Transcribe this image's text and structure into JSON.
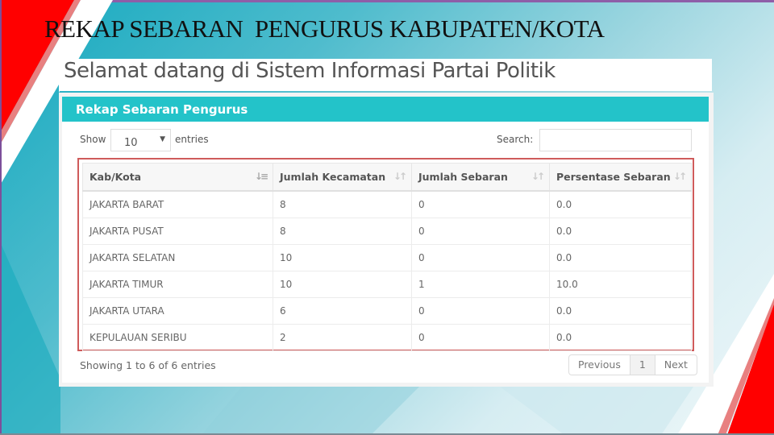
{
  "slide": {
    "title": "REKAP SEBARAN  PENGURUS KABUPATEN/KOTA"
  },
  "app": {
    "welcome": "Selamat datang di Sistem Informasi Partai Politik"
  },
  "panel": {
    "title": "Rekap Sebaran Pengurus",
    "show_label": "Show",
    "entries_value": "10",
    "entries_label": "entries",
    "search_label": "Search:",
    "search_value": "",
    "columns": [
      {
        "label": "Kab/Kota",
        "sort": "sorted-ascending"
      },
      {
        "label": "Jumlah Kecamatan",
        "sort": "sortable"
      },
      {
        "label": "Jumlah Sebaran",
        "sort": "sortable"
      },
      {
        "label": "Persentase Sebaran",
        "sort": "sortable"
      }
    ],
    "rows": [
      [
        "JAKARTA BARAT",
        "8",
        "0",
        "0.0"
      ],
      [
        "JAKARTA PUSAT",
        "8",
        "0",
        "0.0"
      ],
      [
        "JAKARTA SELATAN",
        "10",
        "0",
        "0.0"
      ],
      [
        "JAKARTA TIMUR",
        "10",
        "1",
        "10.0"
      ],
      [
        "JAKARTA UTARA",
        "6",
        "0",
        "0.0"
      ],
      [
        "KEPULAUAN SERIBU",
        "2",
        "0",
        "0.0"
      ]
    ],
    "info": "Showing 1 to 6 of 6 entries",
    "pagination": {
      "previous": "Previous",
      "current": "1",
      "next": "Next"
    }
  },
  "colors": {
    "header_teal": "#23c3c9",
    "highlight_red": "#cf5b5b",
    "accent_red": "#ff0000"
  }
}
